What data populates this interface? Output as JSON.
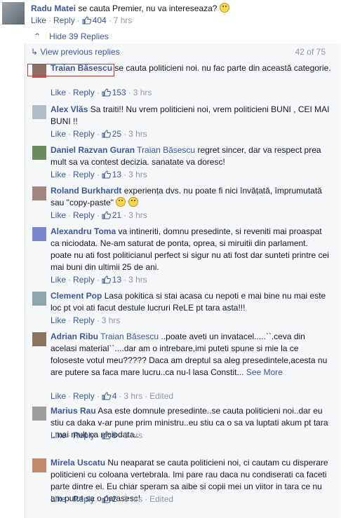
{
  "top_comment": {
    "author": "Radu Matei",
    "text": "se cauta Premier, nu va intereseaza?",
    "like": "Like",
    "reply": "Reply",
    "likes": "404",
    "time": "7 hrs"
  },
  "hide_replies": "Hide 39 Replies",
  "view_previous": "View previous replies",
  "reply_count": "42 of 75",
  "replies": [
    {
      "author": "Traian Băsescu",
      "tag": "",
      "text": "se cauta politicieni noi. nu fac parte din această categorie.",
      "like": "Like",
      "reply": "Reply",
      "likes": "153",
      "time": "3 hrs",
      "edited": ""
    },
    {
      "author": "Alex Vlăs",
      "tag": "",
      "text": "Sa traiti!! Nu vrem politicieni noi, vrem politicieni BUNI , CEI MAI BUNI !!",
      "like": "Like",
      "reply": "Reply",
      "likes": "25",
      "time": "3 hrs",
      "edited": ""
    },
    {
      "author": "Daniel Razvan Guran",
      "tag": "Traian Băsescu",
      "text": "regret sincer, dar va respect prea mult sa va contest decizia. sanatate va doresc!",
      "like": "Like",
      "reply": "Reply",
      "likes": "13",
      "time": "3 hrs",
      "edited": ""
    },
    {
      "author": "Roland Burkhardt",
      "tag": "",
      "text": "experiența dvs. nu poate fi nici învățată, împrumutată sau \"copy-paste\"",
      "like": "Like",
      "reply": "Reply",
      "likes": "21",
      "time": "3 hrs",
      "edited": ""
    },
    {
      "author": "Alexandru Toma",
      "tag": "",
      "text": "va intineriti, domnu presedinte, si reveniti mai proaspat ca niciodata. Ne-am saturat de ponta, oprea, si miruitii din parlament. poate nu ati fost politicianul perfect si sigur nu ati fost dar sunteti printre cei mai buni din ultimii 25 de ani.",
      "like": "Like",
      "reply": "Reply",
      "likes": "13",
      "time": "3 hrs",
      "edited": ""
    },
    {
      "author": "Clement Pop",
      "tag": "",
      "text": "Lasa pokitica si stai acasa cu nepoti e mai bine nu mai este loc pt voi ati facut destule lucruri ReLE pt tara asta!!!",
      "like": "Like",
      "reply": "Reply",
      "likes": "",
      "time": "3 hrs",
      "edited": ""
    },
    {
      "author": "Adrian Ribu",
      "tag": "Traian Băsescu",
      "text": "..poate aveti un invatacel.....``.ceva din acelasi material``....dar am o intrebare,imi puteti spune si mie la ce foloseste votul meu????? Daca am dreptul sa aleg presedintele,acesta nu are putere sa faca mare lucru..ca nu-l lasa Constit...",
      "seemore": "See More",
      "like": "Like",
      "reply": "Reply",
      "likes": "4",
      "time": "3 hrs",
      "edited": "Edited"
    },
    {
      "author": "Marius Rau",
      "tag": "",
      "text": "Asa este domnule presedinte..se cauta politicieni noi..dar eu stiu ca daka v-ar pune prim ministru..eu stiu ca o sa va luptati akum pt tara ..mai mult ca niciodata..",
      "like": "Like",
      "reply": "Reply",
      "likes": "8",
      "time": "3 hrs",
      "edited": ""
    },
    {
      "author": "Mirela Uscatu",
      "tag": "",
      "text": "Nu neaparat se cauta politicieni noi, ci cautam cu disperare politicieni cu coloana vertebrala. Imi pare rau daca nu condiserati ca faceti parte dintre ei. Eu chiar speram sa aibe si copii mei un viitor in tara ce nu am putut sa o parasesc!",
      "like": "Like",
      "reply": "Reply",
      "likes": "2",
      "time": "3 hrs",
      "edited": "Edited"
    }
  ],
  "colors": {
    "link": "#3b5998",
    "meta": "#9197a3",
    "thread_bg": "#f6f7f9",
    "highlight": "#c0392b"
  }
}
